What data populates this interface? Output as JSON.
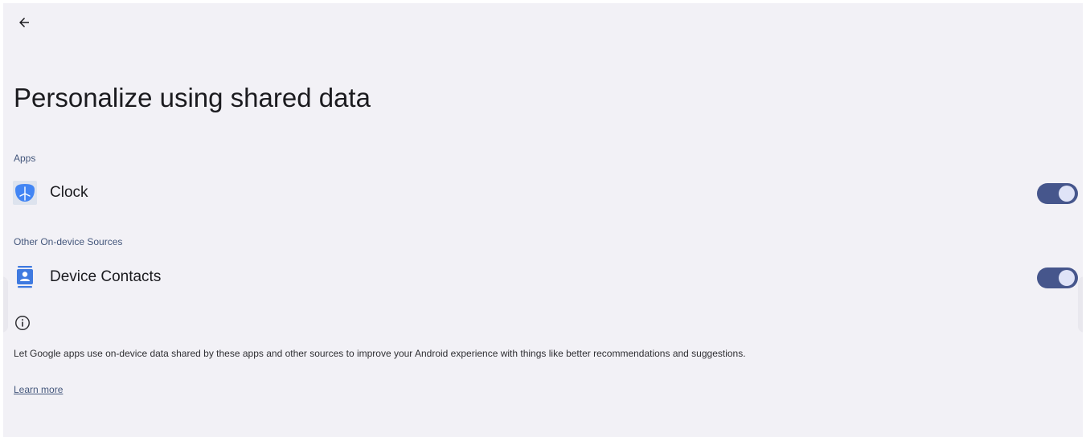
{
  "header": {
    "back_icon": "arrow-back-icon",
    "title": "Personalize using shared data"
  },
  "sections": {
    "apps": {
      "label": "Apps",
      "items": [
        {
          "label": "Clock",
          "icon": "clock-app-icon",
          "enabled": true
        }
      ]
    },
    "other_sources": {
      "label": "Other On-device Sources",
      "items": [
        {
          "label": "Device Contacts",
          "icon": "contacts-icon",
          "enabled": true
        }
      ]
    }
  },
  "info": {
    "icon": "info-icon",
    "description": "Let Google apps use on-device data shared by these apps and other sources to improve your Android experience with things like better recommendations and suggestions.",
    "learn_more": "Learn more"
  },
  "colors": {
    "background": "#f2f1f6",
    "accent": "#46568c",
    "section_label": "#44577c",
    "clock_icon": "#4285f4",
    "contacts_icon": "#3f7ae0"
  }
}
